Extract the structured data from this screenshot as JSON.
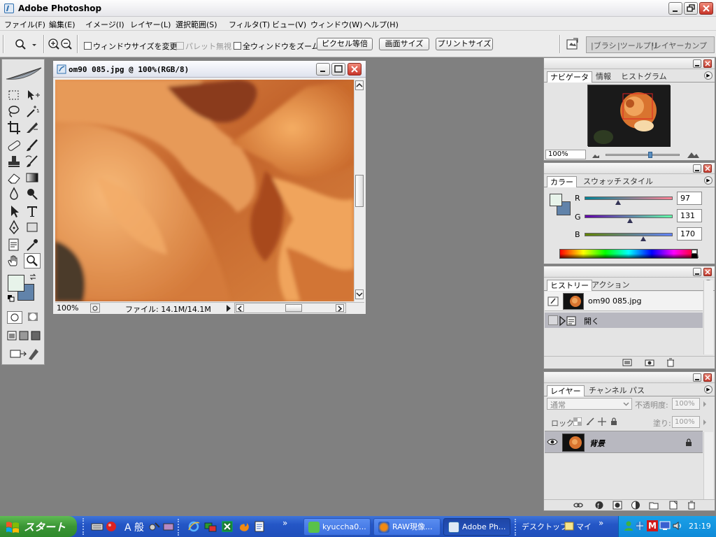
{
  "app": {
    "title": "Adobe Photoshop"
  },
  "menu": [
    "ファイル(F)",
    "編集(E)",
    "イメージ(I)",
    "レイヤー(L)",
    "選択範囲(S)",
    "フィルタ(T)",
    "ビュー(V)",
    "ウィンドウ(W)",
    "ヘルプ(H)"
  ],
  "options": {
    "resize_window": "ウィンドウサイズを変更",
    "ignore_palettes": "パレット無視",
    "zoom_all": "全ウィンドウをズーム",
    "actual_pixels": "ピクセル等倍",
    "fit_screen": "画面サイズ",
    "print_size": "プリントサイズ"
  },
  "palette_well": [
    "ブラシ",
    "ツールプリ",
    "レイヤーカンプ"
  ],
  "document": {
    "title": "om90 085.jpg @ 100%(RGB/8)",
    "zoom": "100%",
    "file_info": "ファイル: 14.1M/14.1M"
  },
  "navigator": {
    "tabs": [
      "ナビゲータ",
      "情報",
      "ヒストグラム"
    ],
    "zoom": "100%",
    "zoom_slider": 0.6
  },
  "color": {
    "tabs": [
      "カラー",
      "スウォッチ",
      "スタイル"
    ],
    "r_label": "R",
    "g_label": "G",
    "b_label": "B",
    "r": "97",
    "g": "131",
    "b": "170",
    "foreground": "#e7f3ea",
    "background": "#6183aa"
  },
  "history": {
    "tabs": [
      "ヒストリー",
      "アクション"
    ],
    "snapshot": "om90 085.jpg",
    "items": [
      "開く"
    ]
  },
  "layers": {
    "tabs": [
      "レイヤー",
      "チャンネル",
      "パス"
    ],
    "blend_mode": "通常",
    "opacity_label": "不透明度:",
    "opacity": "100%",
    "lock_label": "ロック:",
    "fill_label": "塗り:",
    "fill": "100%",
    "layer_name": "背景"
  },
  "taskbar": {
    "start": "スタート",
    "quick_text": "A 般",
    "tasks": [
      "kyuccha0...",
      "RAW現像...",
      "Adobe Ph..."
    ],
    "toolbars": [
      "デスクトップ",
      "マイ"
    ],
    "clock": "21:19"
  }
}
